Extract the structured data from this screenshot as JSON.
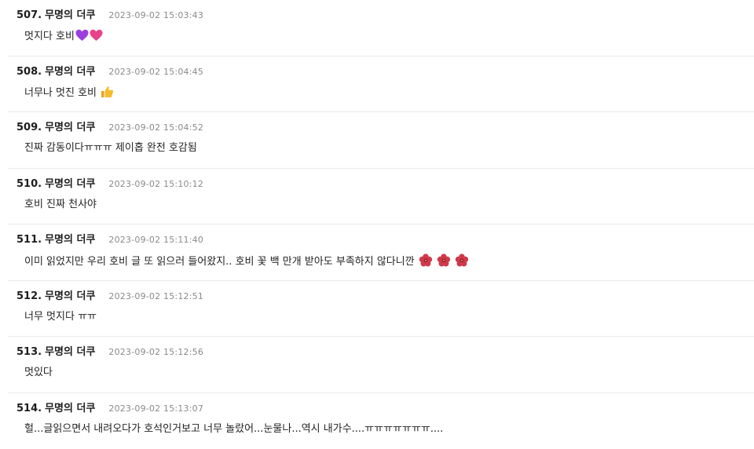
{
  "comments": [
    {
      "num": "507.",
      "author": "무명의 더쿠",
      "date": "2023-09-02 15:03:43",
      "text": "멋지다 호비",
      "emojis": [
        "purple-heart-icon",
        "pink-heart-icon"
      ]
    },
    {
      "num": "508.",
      "author": "무명의 더쿠",
      "date": "2023-09-02 15:04:45",
      "text": "너무나 멋진 호비",
      "emojis": [
        "thumbs-up-icon"
      ]
    },
    {
      "num": "509.",
      "author": "무명의 더쿠",
      "date": "2023-09-02 15:04:52",
      "text": "진짜 감동이다ㅠㅠㅠ 제이홉 완전 호감됨",
      "emojis": []
    },
    {
      "num": "510.",
      "author": "무명의 더쿠",
      "date": "2023-09-02 15:10:12",
      "text": "호비 진짜 천사야",
      "emojis": []
    },
    {
      "num": "511.",
      "author": "무명의 더쿠",
      "date": "2023-09-02 15:11:40",
      "text": "이미 읽었지만 우리 호비 글 또 읽으러 들어왔지.. 호비 꽃 백 만개 받아도 부족하지 않다니깐",
      "emojis": [
        "hibiscus-icon",
        "hibiscus-icon",
        "hibiscus-icon"
      ]
    },
    {
      "num": "512.",
      "author": "무명의 더쿠",
      "date": "2023-09-02 15:12:51",
      "text": "너무 멋지다 ㅠㅠ",
      "emojis": []
    },
    {
      "num": "513.",
      "author": "무명의 더쿠",
      "date": "2023-09-02 15:12:56",
      "text": "멋있다",
      "emojis": []
    },
    {
      "num": "514.",
      "author": "무명의 더쿠",
      "date": "2023-09-02 15:13:07",
      "text": "헐...글읽으면서 내려오다가 호석인거보고 너무 놀랐어...눈물나...역시 내가수....ㅠㅠㅠㅠㅠㅠㅠ....",
      "emojis": []
    }
  ],
  "colors": {
    "text": "#222222",
    "date": "#8a8a8a",
    "divider": "#e9e9e9",
    "purple_heart": "#9b3ee0",
    "pink_heart": "#e8428a",
    "hibiscus": "#d0394b"
  }
}
